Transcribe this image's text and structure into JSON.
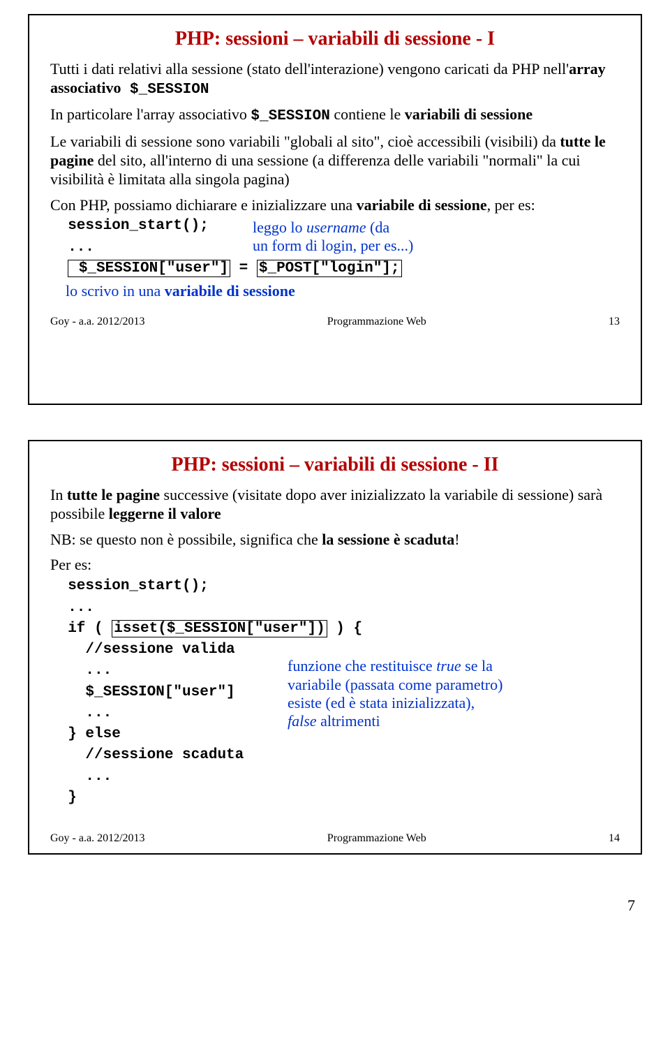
{
  "slide1": {
    "title": "PHP: sessioni – variabili di sessione - I",
    "p1_pre": "Tutti i dati relativi alla sessione (stato dell'interazione) vengono caricati da PHP nell'",
    "p1_bold": "array associativo",
    "p1_code": " $_SESSION",
    "p2_pre": "In particolare l'array associativo ",
    "p2_code": "$_SESSION",
    "p2_post": " contiene le ",
    "p2_bold": "variabili di sessione",
    "p3_pre": "Le variabili di sessione sono variabili \"globali al sito\", cioè accessibili (visibili) da ",
    "p3_bold": "tutte le pagine",
    "p3_post": " del sito, all'interno di una sessione (a differenza delle variabili \"normali\" la cui visibilità è limitata alla singola pagina)",
    "p4_pre": "Con PHP, possiamo dichiarare e inizializzare una ",
    "p4_bold": "variabile di sessione",
    "p4_post": ", per es:",
    "code1": "  session_start();",
    "code2": "  ...",
    "code3a": "  $_SESSION[\"user\"]",
    "code3b": " = ",
    "code3c": "$_POST[\"login\"];",
    "annot1_l1": "leggo lo ",
    "annot1_it": "username",
    "annot1_l2": " (da",
    "annot1_l3": "un form di login, per es...)",
    "annot2_pre": "lo scrivo in una ",
    "annot2_bold": "variabile di sessione",
    "footer_left": "Goy - a.a. 2012/2013",
    "footer_center": "Programmazione Web",
    "footer_right": "13"
  },
  "slide2": {
    "title": "PHP: sessioni – variabili di sessione - II",
    "p1_pre": "In ",
    "p1_bold": "tutte le pagine",
    "p1_mid": " successive (visitate dopo aver inizializzato la variabile di sessione) sarà possibile ",
    "p1_bold2": "leggerne il valore",
    "p2_pre": "NB: se questo non è possibile, significa che ",
    "p2_bold": "la sessione è scaduta",
    "p2_post": "!",
    "p3": "Per es:",
    "c1": "  session_start();",
    "c2": "  ...",
    "c3a": "  if ( ",
    "c3b": "isset($_SESSION[\"user\"])",
    "c3c": " ) {",
    "c4": "    //sessione valida",
    "c5": "    ...",
    "c6": "    $_SESSION[\"user\"]",
    "c7": "    ...",
    "c8": "  } else",
    "c9": "    //sessione scaduta",
    "c10": "    ...",
    "c11": "  }",
    "annot_l1_pre": "funzione che restituisce ",
    "annot_l1_it": "true",
    "annot_l1_post": " se la",
    "annot_l2": "variabile (passata come parametro)",
    "annot_l3": "esiste (ed è stata inizializzata),",
    "annot_l4_it": "false",
    "annot_l4_post": " altrimenti",
    "footer_left": "Goy - a.a. 2012/2013",
    "footer_center": "Programmazione Web",
    "footer_right": "14"
  },
  "pagenum": "7"
}
